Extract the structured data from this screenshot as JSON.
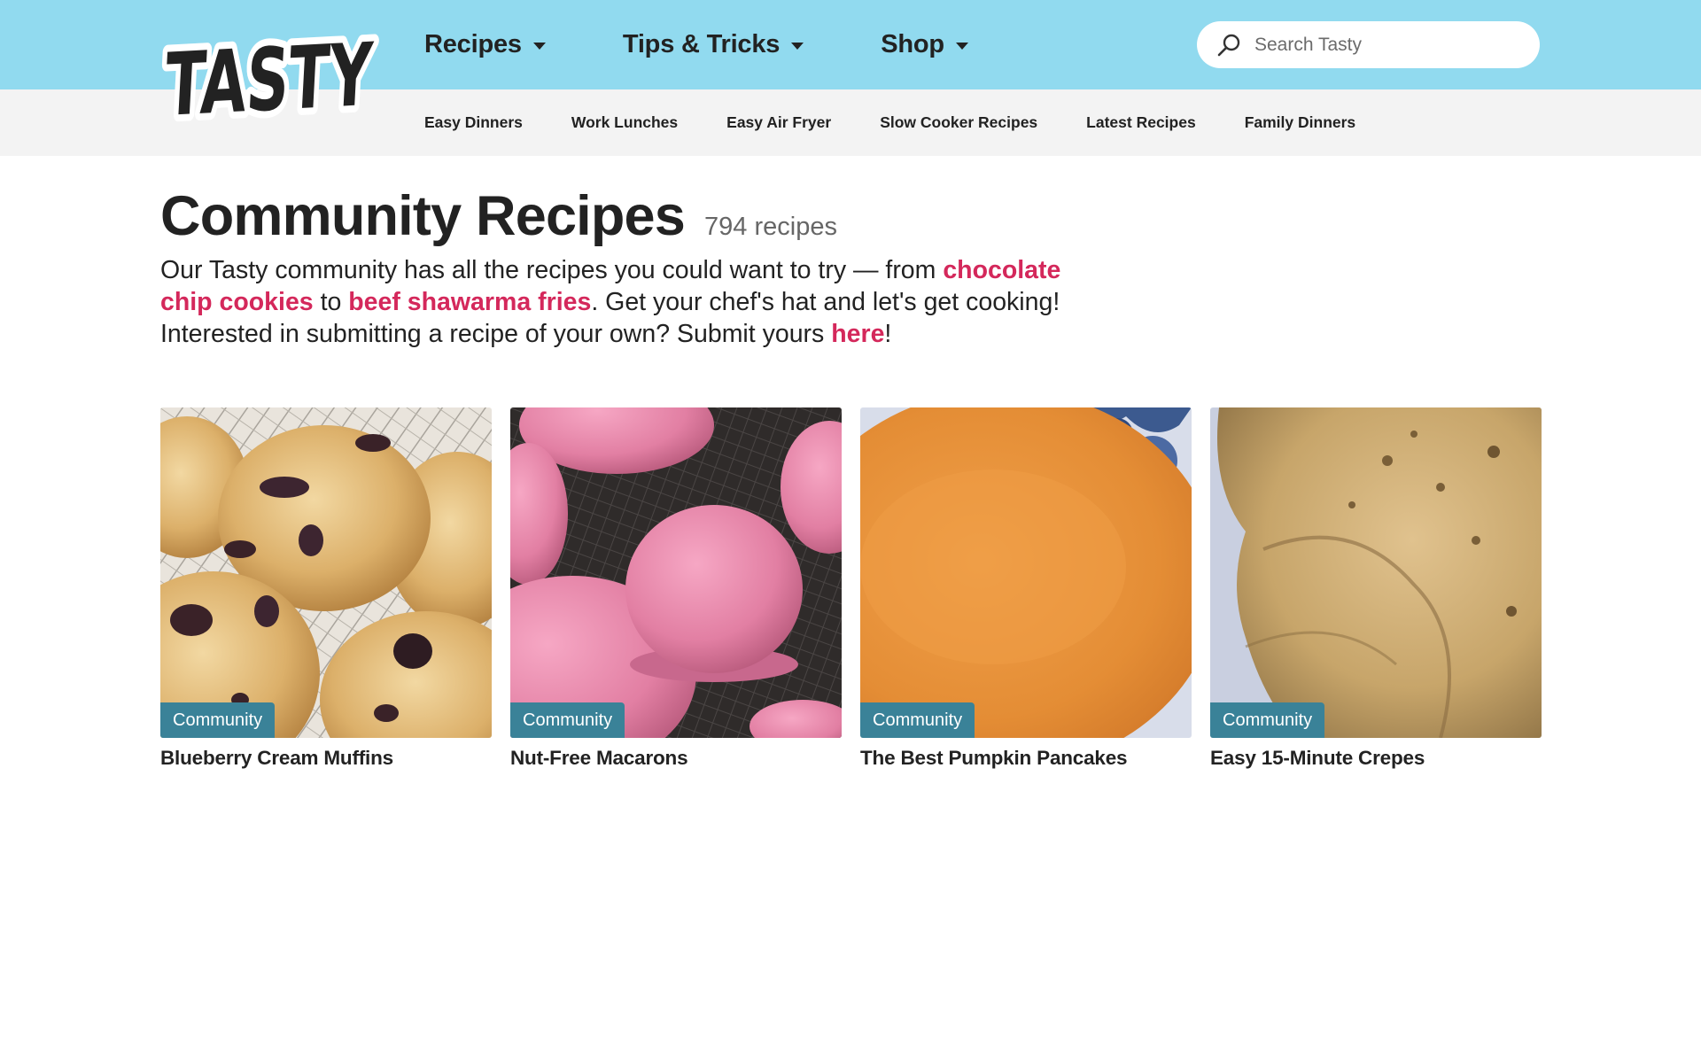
{
  "brand": {
    "logo_text": "TASTY"
  },
  "main_nav": [
    {
      "label": "Recipes"
    },
    {
      "label": "Tips & Tricks"
    },
    {
      "label": "Shop"
    }
  ],
  "search": {
    "placeholder": "Search Tasty",
    "icon": "search-icon"
  },
  "sub_nav": [
    "Easy Dinners",
    "Work Lunches",
    "Easy Air Fryer",
    "Slow Cooker Recipes",
    "Latest Recipes",
    "Family Dinners"
  ],
  "page": {
    "title": "Community Recipes",
    "count": "794 recipes",
    "intro": {
      "t1": "Our Tasty community has all the recipes you could want to try — from ",
      "link1": "chocolate chip cookies",
      "t2": " to ",
      "link2": "beef shawarma fries",
      "t3": ". Get your chef's hat and let's get cooking! Interested in submitting a recipe of your own? Submit yours ",
      "link3": "here",
      "t4": "!"
    }
  },
  "cards": [
    {
      "badge": "Community",
      "title": "Blueberry Cream Muffins"
    },
    {
      "badge": "Community",
      "title": "Nut-Free Macarons"
    },
    {
      "badge": "Community",
      "title": "The Best Pumpkin Pancakes"
    },
    {
      "badge": "Community",
      "title": "Easy 15-Minute Crepes"
    }
  ],
  "colors": {
    "header_bg": "#91daef",
    "subnav_bg": "#f3f3f3",
    "link": "#d4285b",
    "badge_bg": "#3a8298"
  }
}
